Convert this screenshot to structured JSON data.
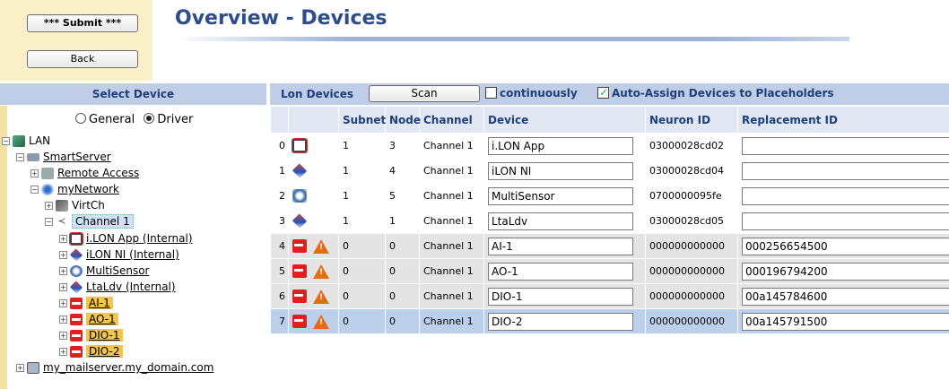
{
  "header": {
    "submit_label": "*** Submit ***",
    "back_label": "Back",
    "title": "Overview - Devices"
  },
  "left_panel": {
    "heading": "Select Device",
    "radio_general": "General",
    "radio_driver": "Driver",
    "selected_radio": "Driver",
    "tree": [
      {
        "label": "LAN",
        "icon": "lan-icon"
      },
      {
        "label": "SmartServer",
        "icon": "server-icon"
      },
      {
        "label": "Remote Access",
        "icon": "phone-icon"
      },
      {
        "label": "myNetwork",
        "icon": "network-icon"
      },
      {
        "label": "VirtCh",
        "icon": "virtual-channel-icon"
      },
      {
        "label": "Channel 1",
        "icon": "channel-icon"
      },
      {
        "label": "i.LON App (Internal)",
        "icon": "ilon-app-icon"
      },
      {
        "label": "iLON NI (Internal)",
        "icon": "ilon-ni-icon"
      },
      {
        "label": "MultiSensor",
        "icon": "multisensor-icon"
      },
      {
        "label": "LtaLdv (Internal)",
        "icon": "ltaldv-icon"
      },
      {
        "label": "AI-1",
        "icon": "placeholder-device-icon"
      },
      {
        "label": "AO-1",
        "icon": "placeholder-device-icon"
      },
      {
        "label": "DIO-1",
        "icon": "placeholder-device-icon"
      },
      {
        "label": "DIO-2",
        "icon": "placeholder-device-icon"
      },
      {
        "label": "my_mailserver.my_domain.com",
        "icon": "mailserver-icon"
      }
    ]
  },
  "lon_devices": {
    "heading": "Lon Devices",
    "scan_label": "Scan",
    "continuously_label": "continuously",
    "continuously_checked": false,
    "auto_assign_label": "Auto-Assign Devices to Placeholders",
    "auto_assign_checked": true,
    "columns": [
      "Subnet",
      "Node",
      "Channel",
      "Device",
      "Neuron ID",
      "Replacement ID"
    ],
    "rows": [
      {
        "index": "0",
        "subnet": "1",
        "node": "3",
        "channel": "Channel 1",
        "device": "i.LON App",
        "neuron_id": "03000028cd02",
        "replacement_id": "",
        "icon": "ilon-app-icon",
        "warning": false
      },
      {
        "index": "1",
        "subnet": "1",
        "node": "4",
        "channel": "Channel 1",
        "device": "iLON NI",
        "neuron_id": "03000028cd04",
        "replacement_id": "",
        "icon": "ilon-ni-icon",
        "warning": false
      },
      {
        "index": "2",
        "subnet": "1",
        "node": "5",
        "channel": "Channel 1",
        "device": "MultiSensor",
        "neuron_id": "0700000095fe",
        "replacement_id": "",
        "icon": "multisensor-icon",
        "warning": false
      },
      {
        "index": "3",
        "subnet": "1",
        "node": "1",
        "channel": "Channel 1",
        "device": "LtaLdv",
        "neuron_id": "03000028cd05",
        "replacement_id": "",
        "icon": "ltaldv-icon",
        "warning": false
      },
      {
        "index": "4",
        "subnet": "0",
        "node": "0",
        "channel": "Channel 1",
        "device": "AI-1",
        "neuron_id": "000000000000",
        "replacement_id": "000256654500",
        "icon": "placeholder-device-icon",
        "warning": true
      },
      {
        "index": "5",
        "subnet": "0",
        "node": "0",
        "channel": "Channel 1",
        "device": "AO-1",
        "neuron_id": "000000000000",
        "replacement_id": "000196794200",
        "icon": "placeholder-device-icon",
        "warning": true
      },
      {
        "index": "6",
        "subnet": "0",
        "node": "0",
        "channel": "Channel 1",
        "device": "DIO-1",
        "neuron_id": "000000000000",
        "replacement_id": "00a145784600",
        "icon": "placeholder-device-icon",
        "warning": true
      },
      {
        "index": "7",
        "subnet": "0",
        "node": "0",
        "channel": "Channel 1",
        "device": "DIO-2",
        "neuron_id": "000000000000",
        "replacement_id": "00a145791500",
        "icon": "placeholder-device-icon",
        "warning": true
      }
    ]
  },
  "colors": {
    "title": "#2e4c8c",
    "header_bar": "#bfcee6",
    "tree_highlight": "#f2c451",
    "active_row": "#bcd0ec",
    "warning": "#e86b10",
    "placeholder_red": "#e21f1f"
  }
}
